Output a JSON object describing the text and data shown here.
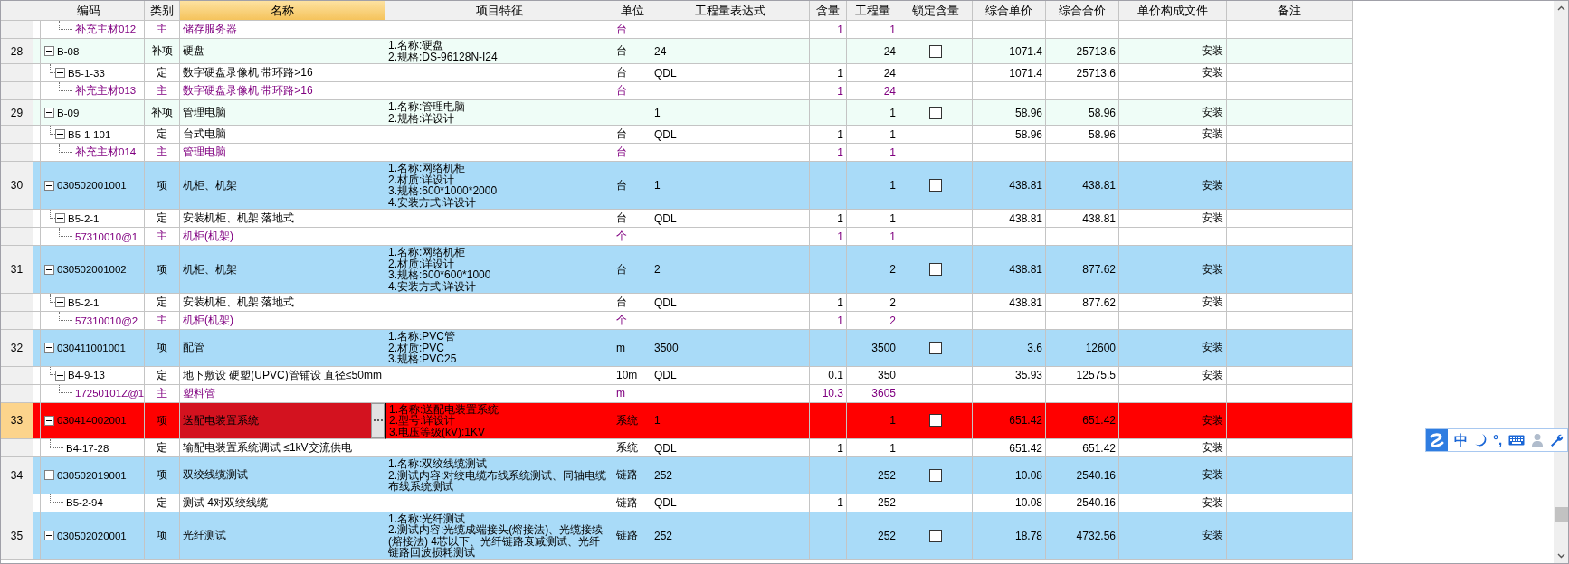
{
  "columns": [
    {
      "label": "编码",
      "selected": false
    },
    {
      "label": "类别",
      "selected": false
    },
    {
      "label": "名称",
      "selected": true
    },
    {
      "label": "项目特征",
      "selected": false
    },
    {
      "label": "单位",
      "selected": false
    },
    {
      "label": "工程量表达式",
      "selected": false
    },
    {
      "label": "含量",
      "selected": false
    },
    {
      "label": "工程量",
      "selected": false
    },
    {
      "label": "锁定含量",
      "selected": false
    },
    {
      "label": "综合单价",
      "selected": false
    },
    {
      "label": "综合合价",
      "selected": false
    },
    {
      "label": "单价构成文件",
      "selected": false
    },
    {
      "label": "备注",
      "selected": false
    }
  ],
  "rows": [
    {
      "kind": "material",
      "selected": false,
      "code": "补充主材012",
      "category": "主",
      "name": "储存服务器",
      "unit": "台",
      "content": "1",
      "quantity": "1"
    },
    {
      "kind": "supplement",
      "selected": false,
      "expanded": true,
      "number": "28",
      "code": "B-08",
      "category": "补项",
      "name": "硬盘",
      "features": [
        "1.名称:硬盘",
        "2.规格:DS-96128N-I24"
      ],
      "unit": "台",
      "expression": "24",
      "quantity": "24",
      "locked": false,
      "unit_price": "1071.4",
      "total": "25713.6",
      "price_file": "安装",
      "children": [
        {
          "kind": "quota",
          "selected": false,
          "expanded": true,
          "code": "B5-1-33",
          "category": "定",
          "name": "数字硬盘录像机 带环路>16",
          "unit": "台",
          "expression": "QDL",
          "content": "1",
          "quantity": "24",
          "unit_price": "1071.4",
          "total": "25713.6",
          "price_file": "安装",
          "children": [
            {
              "kind": "material",
              "selected": false,
              "code": "补充主材013",
              "category": "主",
              "name": "数字硬盘录像机 带环路>16",
              "unit": "台",
              "content": "1",
              "quantity": "24"
            }
          ]
        }
      ]
    },
    {
      "kind": "supplement",
      "selected": false,
      "expanded": true,
      "number": "29",
      "code": "B-09",
      "category": "补项",
      "name": "管理电脑",
      "features": [
        "1.名称:管理电脑",
        "2.规格:详设计"
      ],
      "expression": "1",
      "quantity": "1",
      "locked": false,
      "unit_price": "58.96",
      "total": "58.96",
      "price_file": "安装",
      "children": [
        {
          "kind": "quota",
          "selected": false,
          "expanded": true,
          "code": "B5-1-101",
          "category": "定",
          "name": "台式电脑",
          "unit": "台",
          "expression": "QDL",
          "content": "1",
          "quantity": "1",
          "unit_price": "58.96",
          "total": "58.96",
          "price_file": "安装",
          "children": [
            {
              "kind": "material",
              "selected": false,
              "code": "补充主材014",
              "category": "主",
              "name": "管理电脑",
              "unit": "台",
              "content": "1",
              "quantity": "1"
            }
          ]
        }
      ]
    },
    {
      "kind": "item",
      "selected": false,
      "expanded": true,
      "number": "30",
      "code": "030502001001",
      "category": "项",
      "name": "机柜、机架",
      "features": [
        "1.名称:网络机柜",
        "2.材质:详设计",
        "3.规格:600*1000*2000",
        "4.安装方式:详设计"
      ],
      "unit": "台",
      "expression": "1",
      "quantity": "1",
      "locked": false,
      "unit_price": "438.81",
      "total": "438.81",
      "price_file": "安装",
      "children": [
        {
          "kind": "quota",
          "selected": false,
          "expanded": true,
          "code": "B5-2-1",
          "category": "定",
          "name": "安装机柜、机架 落地式",
          "unit": "台",
          "expression": "QDL",
          "content": "1",
          "quantity": "1",
          "unit_price": "438.81",
          "total": "438.81",
          "price_file": "安装",
          "children": [
            {
              "kind": "material",
              "selected": false,
              "code": "57310010@1",
              "category": "主",
              "name": "机柜(机架)",
              "unit": "个",
              "content": "1",
              "quantity": "1"
            }
          ]
        }
      ]
    },
    {
      "kind": "item",
      "selected": false,
      "expanded": true,
      "number": "31",
      "code": "030502001002",
      "category": "项",
      "name": "机柜、机架",
      "features": [
        "1.名称:网络机柜",
        "2.材质:详设计",
        "3.规格:600*600*1000",
        "4.安装方式:详设计"
      ],
      "unit": "台",
      "expression": "2",
      "quantity": "2",
      "locked": false,
      "unit_price": "438.81",
      "total": "877.62",
      "price_file": "安装",
      "children": [
        {
          "kind": "quota",
          "selected": false,
          "expanded": true,
          "code": "B5-2-1",
          "category": "定",
          "name": "安装机柜、机架 落地式",
          "unit": "台",
          "expression": "QDL",
          "content": "1",
          "quantity": "2",
          "unit_price": "438.81",
          "total": "877.62",
          "price_file": "安装",
          "children": [
            {
              "kind": "material",
              "selected": false,
              "code": "57310010@2",
              "category": "主",
              "name": "机柜(机架)",
              "unit": "个",
              "content": "1",
              "quantity": "2"
            }
          ]
        }
      ]
    },
    {
      "kind": "item",
      "selected": false,
      "expanded": true,
      "number": "32",
      "code": "030411001001",
      "category": "项",
      "name": "配管",
      "features": [
        "1.名称:PVC管",
        "2.材质:PVC",
        "3.规格:PVC25"
      ],
      "unit": "m",
      "expression": "3500",
      "quantity": "3500",
      "locked": false,
      "unit_price": "3.6",
      "total": "12600",
      "price_file": "安装",
      "children": [
        {
          "kind": "quota",
          "selected": false,
          "expanded": true,
          "code": "B4-9-13",
          "category": "定",
          "name": "地下敷设 硬塑(UPVC)管铺设 直径≤50mm",
          "unit": "10m",
          "expression": "QDL",
          "content": "0.1",
          "quantity": "350",
          "unit_price": "35.93",
          "total": "12575.5",
          "price_file": "安装",
          "children": [
            {
              "kind": "material",
              "selected": false,
              "code": "17250101Z@1",
              "category": "主",
              "name": "塑料管",
              "unit": "m",
              "content": "10.3",
              "quantity": "3605"
            }
          ]
        }
      ]
    },
    {
      "kind": "item",
      "selected": true,
      "expanded": true,
      "number": "33",
      "code": "030414002001",
      "category": "项",
      "name": "送配电装置系统",
      "name_button": "⋯",
      "features": [
        "1.名称:送配电装置系统",
        "2.型号:详设计",
        "3.电压等级(kV):1KV"
      ],
      "unit": "系统",
      "expression": "1",
      "quantity": "1",
      "locked": false,
      "unit_price": "651.42",
      "total": "651.42",
      "price_file": "安装",
      "children": [
        {
          "kind": "quota",
          "selected": false,
          "code": "B4-17-28",
          "category": "定",
          "name": "输配电装置系统调试 ≤1kV交流供电",
          "unit": "系统",
          "expression": "QDL",
          "content": "1",
          "quantity": "1",
          "unit_price": "651.42",
          "total": "651.42",
          "price_file": "安装"
        }
      ]
    },
    {
      "kind": "item",
      "selected": false,
      "expanded": true,
      "number": "34",
      "code": "030502019001",
      "category": "项",
      "name": "双绞线缆测试",
      "features": [
        "1.名称:双绞线缆测试",
        "2.测试内容:对绞电缆布线系统测试、同轴电缆布线系统测试"
      ],
      "unit": "链路",
      "expression": "252",
      "quantity": "252",
      "locked": false,
      "unit_price": "10.08",
      "total": "2540.16",
      "price_file": "安装",
      "children": [
        {
          "kind": "quota",
          "selected": false,
          "code": "B5-2-94",
          "category": "定",
          "name": "测试 4对双绞线缆",
          "unit": "链路",
          "expression": "QDL",
          "content": "1",
          "quantity": "252",
          "unit_price": "10.08",
          "total": "2540.16",
          "price_file": "安装"
        }
      ]
    },
    {
      "kind": "item",
      "selected": false,
      "expanded": true,
      "number": "35",
      "code": "030502020001",
      "category": "项",
      "name": "光纤测试",
      "features": [
        "1.名称:光纤测试",
        "2.测试内容:光缆成端接头(熔接法)、光缆接续(熔接法) 4芯以下、光纤链路衰减测试、光纤链路回波损耗测试"
      ],
      "unit": "链路",
      "expression": "252",
      "quantity": "252",
      "locked": false,
      "unit_price": "18.78",
      "total": "4732.56",
      "price_file": "安装"
    }
  ],
  "ime_toolbar": {
    "mode": "中",
    "punctuation": "°,"
  }
}
